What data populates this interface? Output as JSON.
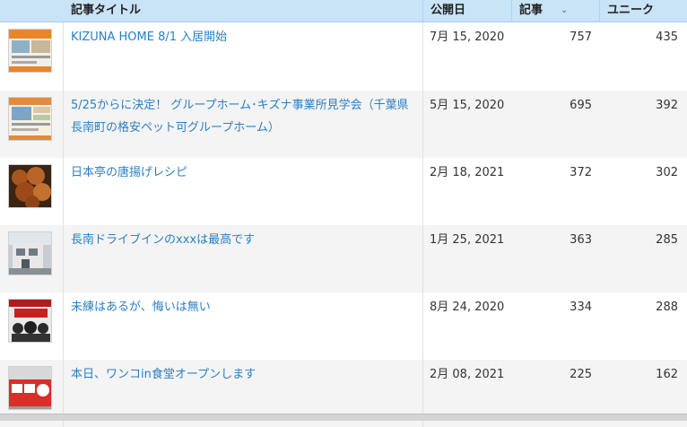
{
  "header": {
    "title_col": "記事タイトル",
    "date_col": "公開日",
    "views_col": "記事",
    "unique_col": "ユニーク"
  },
  "rows": [
    {
      "title": "KIZUNA HOME 8/1 入居開始",
      "date": "7月 15, 2020",
      "views": "757",
      "unique": "435",
      "thumb": "flyer"
    },
    {
      "title": "5/25からに決定！ グループホーム･キズナ事業所見学会（千葉県長南町の格安ペット可グループホーム）",
      "date": "5月 15, 2020",
      "views": "695",
      "unique": "392",
      "thumb": "flyer"
    },
    {
      "title": "日本亭の唐揚げレシピ",
      "date": "2月 18, 2021",
      "views": "372",
      "unique": "302",
      "thumb": "food"
    },
    {
      "title": "長南ドライブインのxxxは最高です",
      "date": "1月 25, 2021",
      "views": "363",
      "unique": "285",
      "thumb": "building"
    },
    {
      "title": "未練はあるが、悔いは無い",
      "date": "8月 24, 2020",
      "views": "334",
      "unique": "288",
      "thumb": "poster"
    },
    {
      "title": "本日、ワンコin食堂オープンします",
      "date": "2月 08, 2021",
      "views": "225",
      "unique": "162",
      "thumb": "sign"
    }
  ],
  "colors": {
    "header_bg": "#c9e3f7",
    "link": "#2a7fc4",
    "alt_row": "#f4f4f4"
  },
  "icons": {
    "sort": "chevron-down-icon"
  }
}
